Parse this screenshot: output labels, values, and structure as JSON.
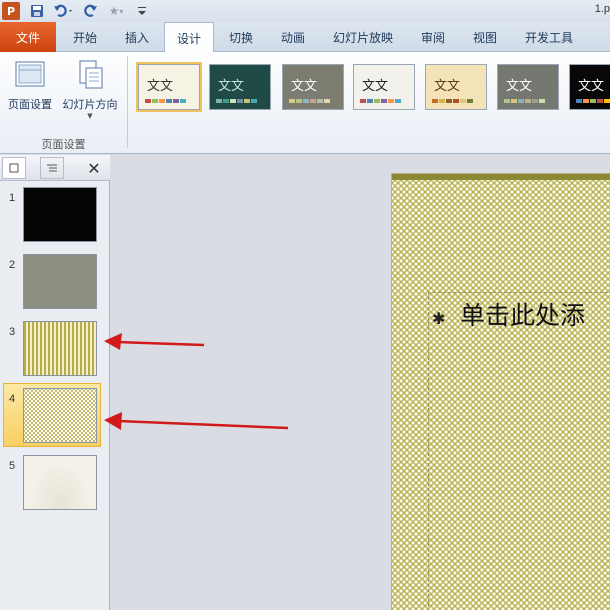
{
  "qat": {
    "title": "1.p",
    "app_icon": "P",
    "icons": [
      "powerpoint-logo-icon",
      "save-icon",
      "undo-icon",
      "redo-icon",
      "star-icon",
      "dropdown-icon"
    ]
  },
  "tabs": [
    {
      "label": "文件"
    },
    {
      "label": "开始"
    },
    {
      "label": "插入"
    },
    {
      "label": "设计"
    },
    {
      "label": "切换"
    },
    {
      "label": "动画"
    },
    {
      "label": "幻灯片放映"
    },
    {
      "label": "审阅"
    },
    {
      "label": "视图"
    },
    {
      "label": "开发工具"
    }
  ],
  "active_tab": "设计",
  "ribbon": {
    "page_setup_label": "页面设置",
    "orientation_label": "幻灯片方向",
    "group_label": "页面设置"
  },
  "themes": [
    {
      "text": "文文",
      "bg": "#f6f2e4",
      "fg": "#333333",
      "swatches": [
        "#c0504d",
        "#9bbb59",
        "#f79646",
        "#4f81bd",
        "#8064a2",
        "#4bacc6"
      ]
    },
    {
      "text": "文文",
      "bg": "#1f4a46",
      "fg": "#bfe8df",
      "swatches": [
        "#73b9a6",
        "#3f9e88",
        "#cfe3bd",
        "#6f8fa9",
        "#c3c36a",
        "#4aa6b5"
      ]
    },
    {
      "text": "文文",
      "bg": "#7c7c70",
      "fg": "#ffffff",
      "swatches": [
        "#dbc87d",
        "#b4c489",
        "#8db5c4",
        "#c9a18f",
        "#b8b8b8",
        "#e3d7a8"
      ]
    },
    {
      "text": "文文",
      "bg": "#f2f1ec",
      "fg": "#222222",
      "swatches": [
        "#c0504d",
        "#4f81bd",
        "#9bbb59",
        "#8064a2",
        "#f79646",
        "#4bacc6"
      ]
    },
    {
      "text": "文文",
      "bg": "#f4e2b8",
      "fg": "#5a3b16",
      "swatches": [
        "#c86b22",
        "#d7b24b",
        "#8c5a2b",
        "#b04b2b",
        "#e3c37d",
        "#6e7f3a"
      ]
    },
    {
      "text": "文文",
      "bg": "#757870",
      "fg": "#ffffff",
      "swatches": [
        "#b3c58e",
        "#d6c77a",
        "#8bb0b6",
        "#c1b08c",
        "#9d9f8c",
        "#d2dba9"
      ]
    },
    {
      "text": "文文",
      "bg": "#080808",
      "fg": "#ffffff",
      "swatches": [
        "#4f81bd",
        "#f79646",
        "#9bbb59",
        "#c0504d",
        "#ffc000",
        "#4bacc6"
      ]
    }
  ],
  "slides": [
    {
      "number": "1"
    },
    {
      "number": "2"
    },
    {
      "number": "3"
    },
    {
      "number": "4"
    },
    {
      "number": "5"
    }
  ],
  "selected_slide": "4",
  "slide_title": "单击此处添"
}
